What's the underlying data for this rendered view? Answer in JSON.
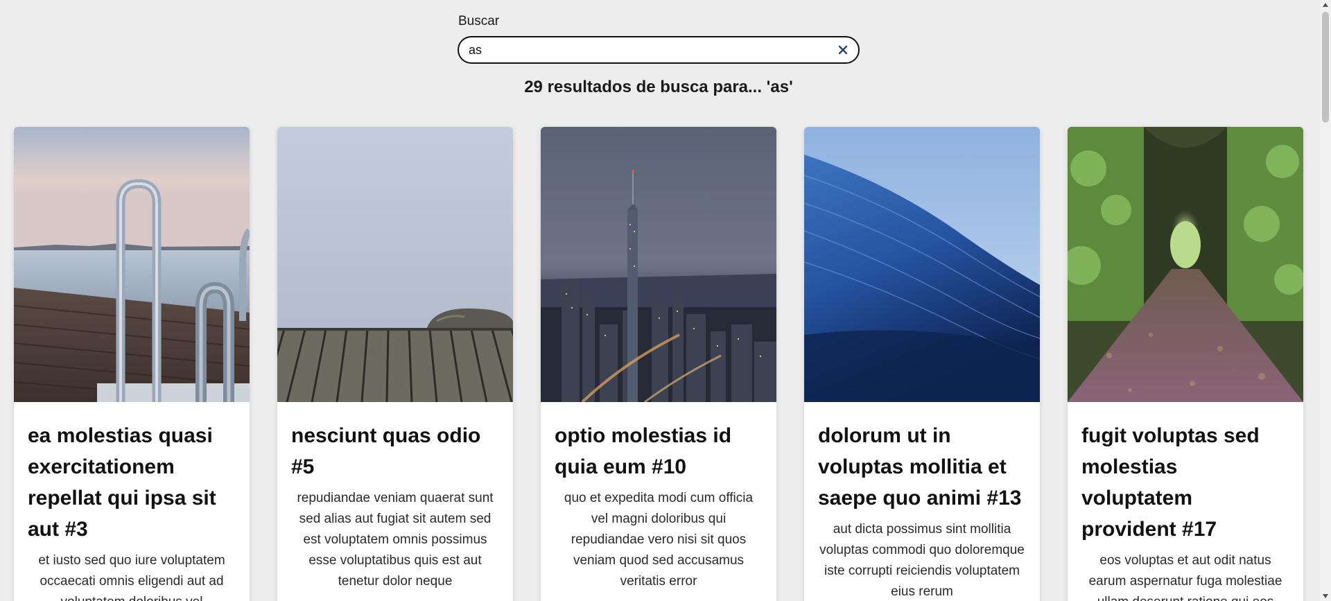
{
  "search": {
    "label": "Buscar",
    "value": "as",
    "clear_icon": "close-icon"
  },
  "results": {
    "summary": "29 resultados de busca para... 'as'"
  },
  "cards": [
    {
      "title": "ea molestias quasi exercitationem repellat qui ipsa sit aut #3",
      "text": "et iusto sed quo iure voluptatem occaecati omnis eligendi aut ad voluptatem doloribus vel",
      "image": "dock-ladder-lake-photo"
    },
    {
      "title": "nesciunt quas odio #5",
      "text": "repudiandae veniam quaerat sunt sed alias aut fugiat sit autem sed est voluptatem omnis possimus esse voluptatibus quis est aut tenetur dolor neque",
      "image": "wooden-pier-fog-photo"
    },
    {
      "title": "optio molestias id quia eum #10",
      "text": "quo et expedita modi cum officia vel magni doloribus qui repudiandae vero nisi sit quos veniam quod sed accusamus veritatis error",
      "image": "city-skyline-night-photo"
    },
    {
      "title": "dolorum ut in voluptas mollitia et saepe quo animi #13",
      "text": "aut dicta possimus sint mollitia voluptas commodi quo doloremque iste corrupti reiciendis voluptatem eius rerum",
      "image": "ocean-wave-photo"
    },
    {
      "title": "fugit voluptas sed molestias voluptatem provident #17",
      "text": "eos voluptas et aut odit natus earum aspernatur fuga molestiae ullam deserunt ratione qui eos",
      "image": "forest-tunnel-path-photo"
    }
  ]
}
